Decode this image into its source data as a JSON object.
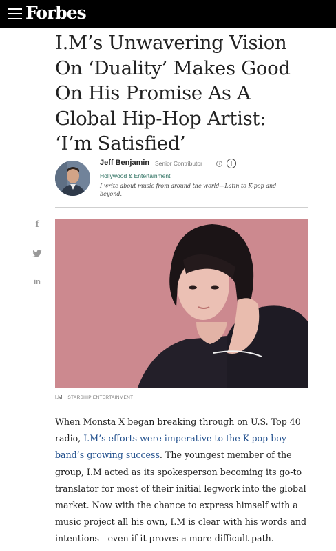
{
  "header": {
    "logo": "Forbes",
    "menu_icon": "hamburger-menu-icon"
  },
  "article": {
    "headline_lines": [
      "I.M’s Unwavering Vision",
      "On ‘Duality’ Makes Good",
      "On His Promise As A",
      "Global Hip-Hop Artist:",
      "‘I’m Satisfied’"
    ],
    "author": {
      "name": "Jeff Benjamin",
      "role": "Senior Contributor",
      "section": "Hollywood & Entertainment",
      "bio": "I write about music from around the world—Latin to K-pop and beyond.",
      "info_icon": "info-icon",
      "follow_icon": "plus-circle-icon"
    },
    "share": {
      "facebook": "f",
      "linkedin": "in",
      "twitter_icon": "twitter-bird-icon"
    },
    "image": {
      "caption": "I.M",
      "credit": "STARSHIP ENTERTAINMENT"
    },
    "body": {
      "l1": "When Monsta X began breaking through on U.S. Top 40",
      "l2_pre": "radio, ",
      "l2_link": "I.M’s efforts were imperative to the K-pop boy",
      "l3_link": "band’s growing success",
      "l3_post": ". The youngest member of the",
      "l4": "group, I.M acted as its spokesperson becoming its go-to",
      "l5": "translator for most of their initial legwork into the global",
      "l6": "market. Now with the chance to express himself with a",
      "l7": "music project all his own, I.M is clear with his words and",
      "l8": "intentions—even if it proves a more difficult path."
    }
  },
  "colors": {
    "topbar": "#000000",
    "link": "#1f4e8c",
    "section": "#2a6e5e"
  }
}
